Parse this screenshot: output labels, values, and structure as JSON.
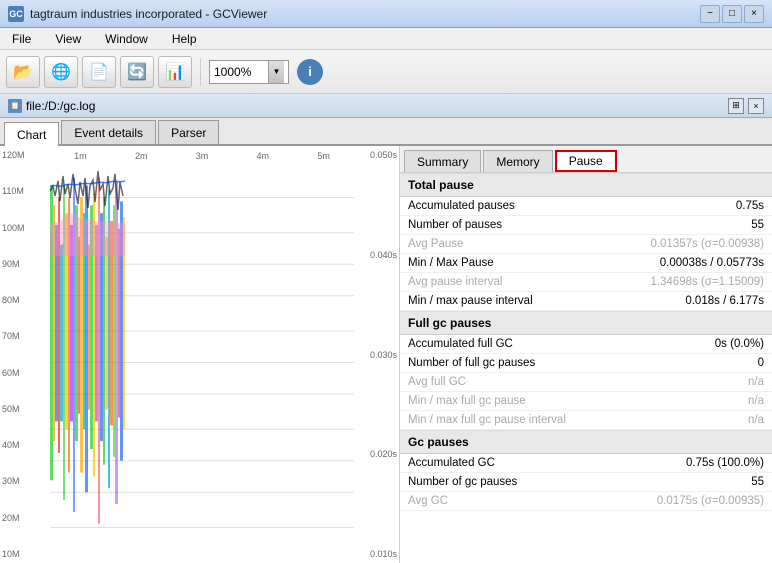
{
  "window": {
    "title": "tagtraum industries incorporated - GCViewer",
    "icon": "GC"
  },
  "titlebar": {
    "minimize": "−",
    "maximize": "□",
    "close": "×"
  },
  "menu": {
    "items": [
      "File",
      "View",
      "Window",
      "Help"
    ]
  },
  "toolbar": {
    "zoom_value": "1000%",
    "zoom_arrow": "▼"
  },
  "filebar": {
    "path": "file:/D:/gc.log",
    "expand": "⊞",
    "close_file": "×"
  },
  "tabs": {
    "chart": "Chart",
    "event_details": "Event details",
    "parser": "Parser"
  },
  "chart": {
    "x_labels": [
      "1m",
      "2m",
      "3m",
      "4m",
      "5m"
    ],
    "y_left_labels": [
      "120M",
      "110M",
      "100M",
      "90M",
      "80M",
      "70M",
      "60M",
      "50M",
      "40M",
      "30M",
      "20M",
      "10M"
    ],
    "y_right_labels": [
      "0.050s",
      "0.040s",
      "0.030s",
      "0.020s",
      "0.010s"
    ]
  },
  "right_panel": {
    "tabs": {
      "summary": "Summary",
      "memory": "Memory",
      "pause": "Pause"
    },
    "active_tab": "pause"
  },
  "pause_data": {
    "sections": [
      {
        "id": "total_pause",
        "header": "Total pause",
        "rows": [
          {
            "label": "Accumulated pauses",
            "value": "0.75s",
            "dimmed": false
          },
          {
            "label": "Number of pauses",
            "value": "55",
            "dimmed": false
          },
          {
            "label": "Avg Pause",
            "value": "0.01357s (σ=0.00938)",
            "dimmed": true
          },
          {
            "label": "Min / Max Pause",
            "value": "0.00038s / 0.05773s",
            "dimmed": false
          },
          {
            "label": "Avg pause interval",
            "value": "1.34698s (σ=1.15009)",
            "dimmed": true
          },
          {
            "label": "Min / max pause interval",
            "value": "0.018s / 6.177s",
            "dimmed": false
          }
        ]
      },
      {
        "id": "full_gc_pauses",
        "header": "Full gc pauses",
        "rows": [
          {
            "label": "Accumulated full GC",
            "value": "0s (0.0%)",
            "dimmed": false
          },
          {
            "label": "Number of full gc pauses",
            "value": "0",
            "dimmed": false
          },
          {
            "label": "Avg full GC",
            "value": "n/a",
            "dimmed": true
          },
          {
            "label": "Min / max full gc pause",
            "value": "n/a",
            "dimmed": true
          },
          {
            "label": "Min / max full gc pause interval",
            "value": "n/a",
            "dimmed": true
          }
        ]
      },
      {
        "id": "gc_pauses",
        "header": "Gc pauses",
        "rows": [
          {
            "label": "Accumulated GC",
            "value": "0.75s (100.0%)",
            "dimmed": false
          },
          {
            "label": "Number of gc pauses",
            "value": "55",
            "dimmed": false
          },
          {
            "label": "Avg GC",
            "value": "0.0175s (σ=0.00935)",
            "dimmed": true
          }
        ]
      }
    ]
  }
}
